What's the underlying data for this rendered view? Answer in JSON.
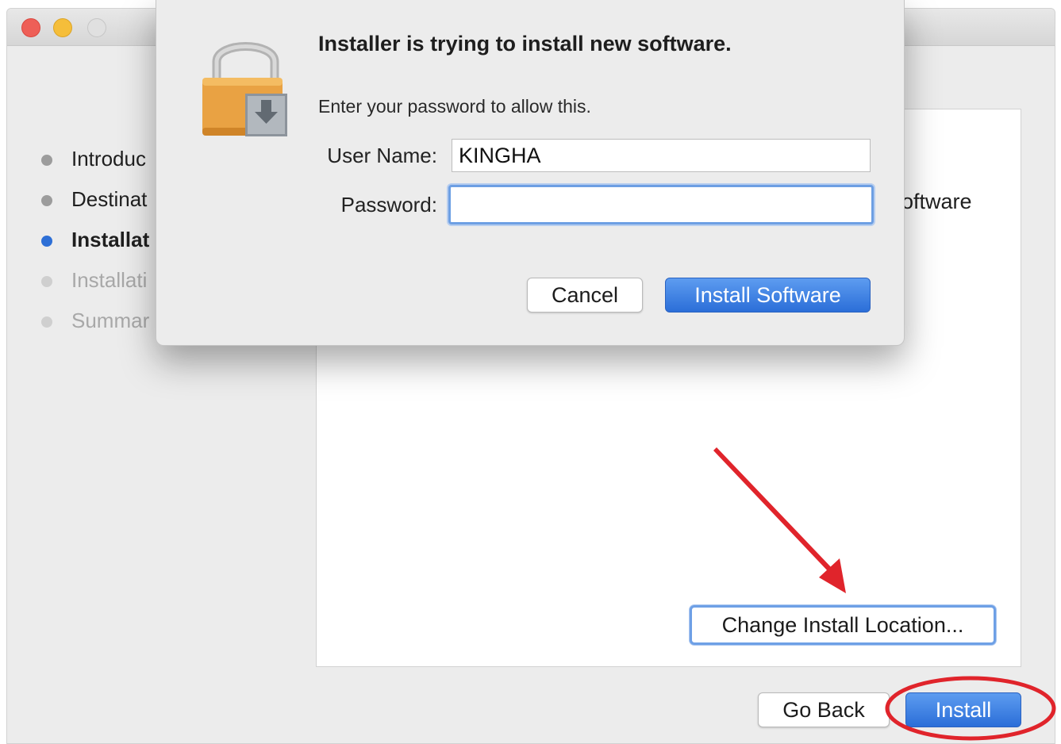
{
  "window": {
    "traffic_lights": [
      "close",
      "minimize",
      "zoom"
    ]
  },
  "sidebar": {
    "steps": [
      {
        "label": "Introduc",
        "state": "done"
      },
      {
        "label": "Destinat",
        "state": "done"
      },
      {
        "label": "Installat",
        "state": "current"
      },
      {
        "label": "Installati",
        "state": "future"
      },
      {
        "label": "Summar",
        "state": "future"
      }
    ]
  },
  "pane": {
    "partial_text": "oftware",
    "change_location_label": "Change Install Location..."
  },
  "footer": {
    "go_back_label": "Go Back",
    "install_label": "Install"
  },
  "dialog": {
    "title": "Installer is trying to install new software.",
    "message": "Enter your password to allow this.",
    "username_label": "User Name:",
    "username_value": "KINGHA",
    "password_label": "Password:",
    "password_value": "",
    "cancel_label": "Cancel",
    "confirm_label": "Install Software"
  },
  "colors": {
    "accent": "#2d6fd6",
    "annotation": "#e0242b",
    "window_bg": "#ececec"
  }
}
